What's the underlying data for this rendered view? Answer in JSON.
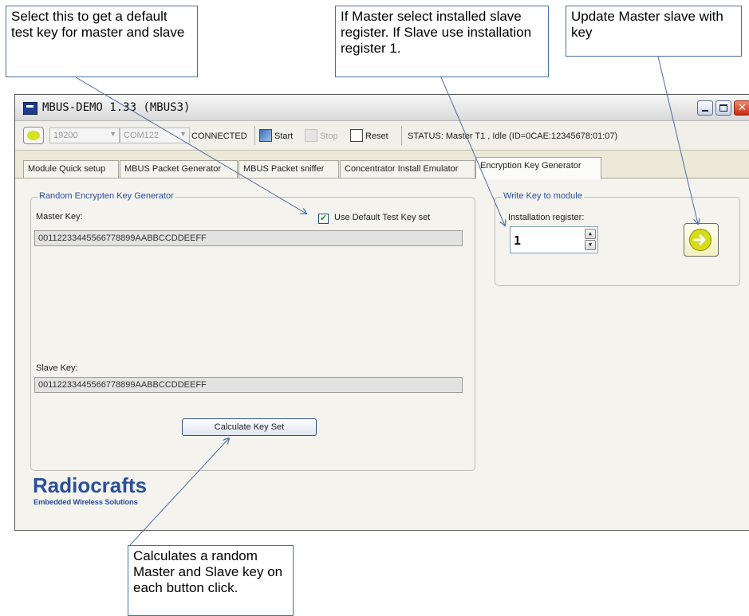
{
  "callouts": {
    "default_key": "Select this to get a default test key for master and slave",
    "install_register": "If Master select installed slave register. If Slave use installation register 1.",
    "update_master": "Update Master slave with key",
    "calculate": "Calculates a random Master and Slave key on each button click."
  },
  "window": {
    "title": "MBUS-DEMO 1.33 (MBUS3)"
  },
  "toolbar": {
    "baud_value": "19200",
    "port_value": "COM122",
    "connection_status": "CONNECTED",
    "start_label": "Start",
    "stop_label": "Stop",
    "reset_label": "Reset",
    "status_text": "STATUS: Master T1 , Idle  (ID=0CAE:12345678:01:07)"
  },
  "tabs": [
    {
      "label": "Module Quick setup"
    },
    {
      "label": "MBUS Packet Generator"
    },
    {
      "label": "MBUS Packet sniffer"
    },
    {
      "label": "Concentrator Install Emulator"
    },
    {
      "label": "Encryption Key Generator"
    }
  ],
  "key_generator": {
    "group_title": "Random Encrypten Key Generator",
    "master_label": "Master Key:",
    "master_value": "00112233445566778899AABBCCDDEEFF",
    "use_default_label": "Use Default Test Key set",
    "use_default_checked": true,
    "slave_label": "Slave Key:",
    "slave_value": "00112233445566778899AABBCCDDEEFF",
    "calculate_label": "Calculate Key Set"
  },
  "write_key": {
    "group_title": "Write Key to module",
    "register_label": "Installation register:",
    "register_value": "1"
  },
  "logo": {
    "name": "Radiocrafts",
    "tagline": "Embedded Wireless Solutions"
  },
  "colors": {
    "accent_blue": "#2b4f9a",
    "led_yellow": "#d6e21a",
    "callout_border": "#4a6fa5"
  },
  "icons": {
    "app": "app-icon",
    "led": "connection-led-icon",
    "start": "start-icon",
    "stop": "stop-icon",
    "reset": "reset-icon",
    "write": "arrow-right-circle-icon"
  }
}
